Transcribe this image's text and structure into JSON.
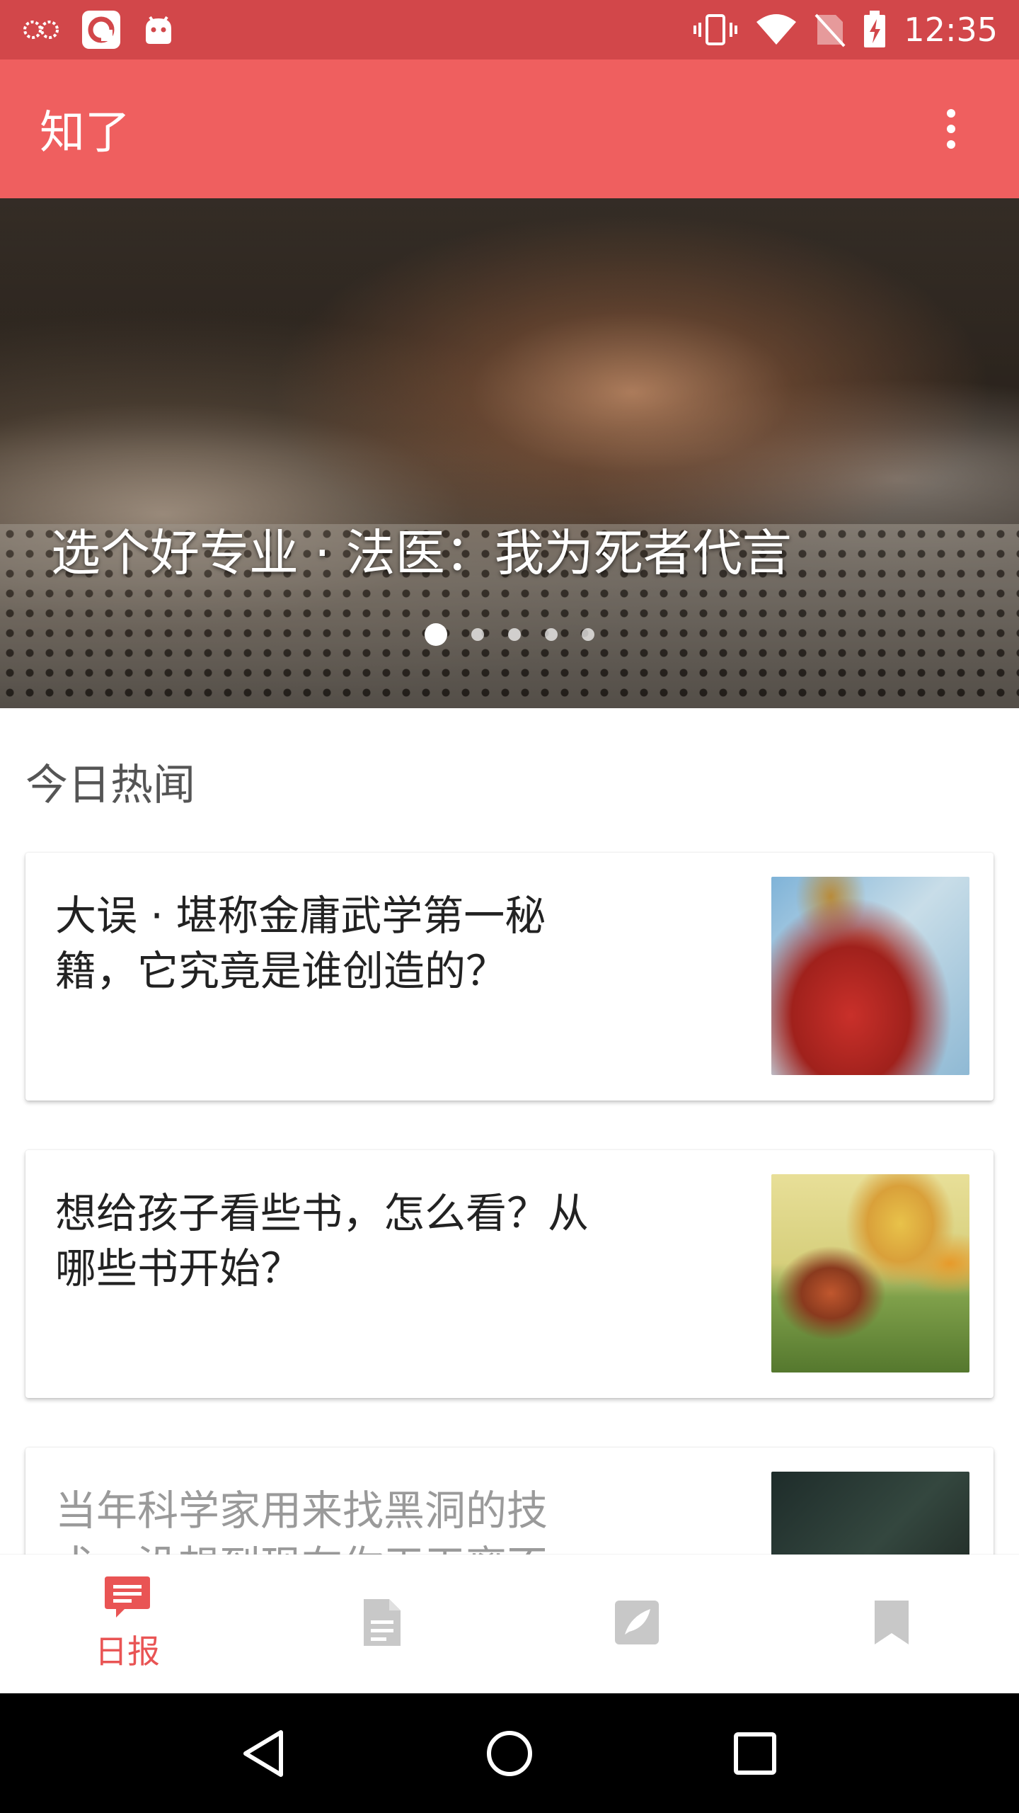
{
  "status_bar": {
    "time": "12:35",
    "left_icons": [
      "infinity-icon",
      "app-q-icon",
      "android-icon"
    ],
    "right_icons": [
      "vibrate-icon",
      "wifi-icon",
      "no-sim-icon",
      "battery-charging-icon"
    ]
  },
  "app_bar": {
    "title": "知了",
    "overflow_icon": "more-vert-icon"
  },
  "banner": {
    "title": "选个好专业 · 法医：我为死者代言",
    "dots_count": 5,
    "active_dot": 0
  },
  "section": {
    "title": "今日热闻"
  },
  "stories": [
    {
      "title": "大误 · 堪称金庸武学第一秘籍，它究竟是谁创造的？"
    },
    {
      "title": "想给孩子看些书，怎么看？从哪些书开始？"
    },
    {
      "title": "当年科学家用来找黑洞的技术，没想到现在你天天离不"
    }
  ],
  "bottom_nav": {
    "items": [
      {
        "label": "日报",
        "icon": "daily-news-icon",
        "active": true
      },
      {
        "label": "",
        "icon": "document-icon",
        "active": false
      },
      {
        "label": "",
        "icon": "edit-feather-icon",
        "active": false
      },
      {
        "label": "",
        "icon": "bookmark-icon",
        "active": false
      }
    ]
  },
  "colors": {
    "status_bar": "#d2474a",
    "app_bar": "#ef5f5f",
    "accent": "#e95454",
    "inactive_icon": "#c8c8c8"
  }
}
